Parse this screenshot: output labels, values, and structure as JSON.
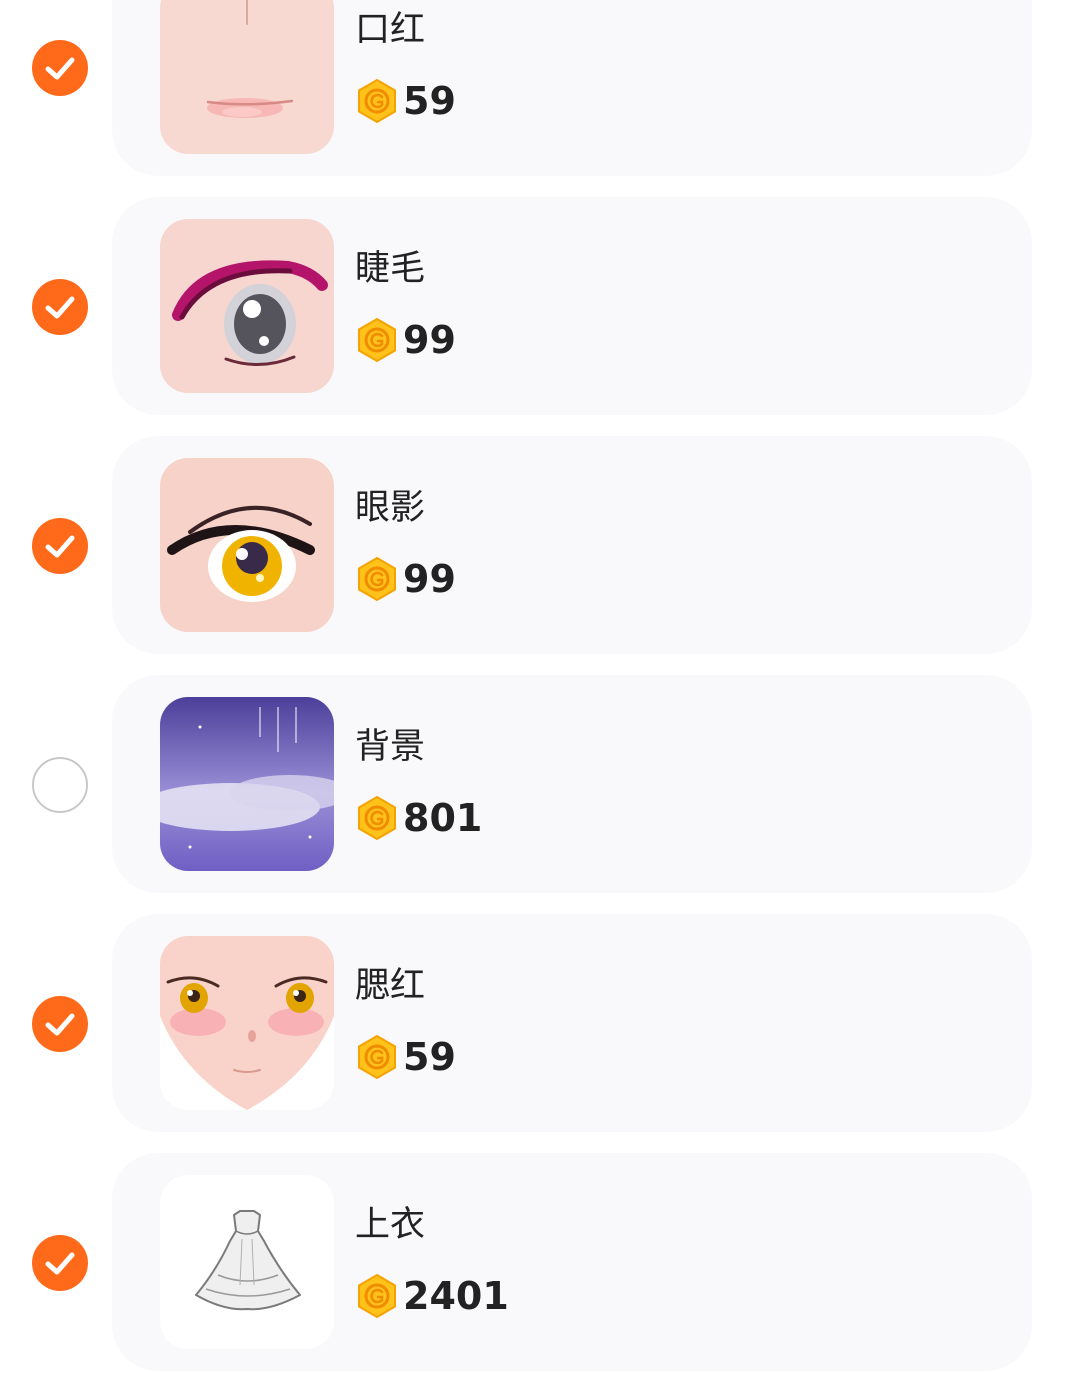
{
  "items": [
    {
      "name": "口红",
      "price": "59",
      "selected": true,
      "thumb": "lipstick"
    },
    {
      "name": "睫毛",
      "price": "99",
      "selected": true,
      "thumb": "eyelash"
    },
    {
      "name": "眼影",
      "price": "99",
      "selected": true,
      "thumb": "eyeshadow"
    },
    {
      "name": "背景",
      "price": "801",
      "selected": false,
      "thumb": "background"
    },
    {
      "name": "腮红",
      "price": "59",
      "selected": true,
      "thumb": "blush"
    },
    {
      "name": "上衣",
      "price": "2401",
      "selected": true,
      "thumb": "top"
    }
  ],
  "icons": {
    "check": "checkmark-icon",
    "coin": "gold-coin-icon"
  },
  "colors": {
    "accent": "#ff6a1a",
    "card_background": "#f9f8fb",
    "coin": "#ffc21a",
    "text": "#222222"
  }
}
